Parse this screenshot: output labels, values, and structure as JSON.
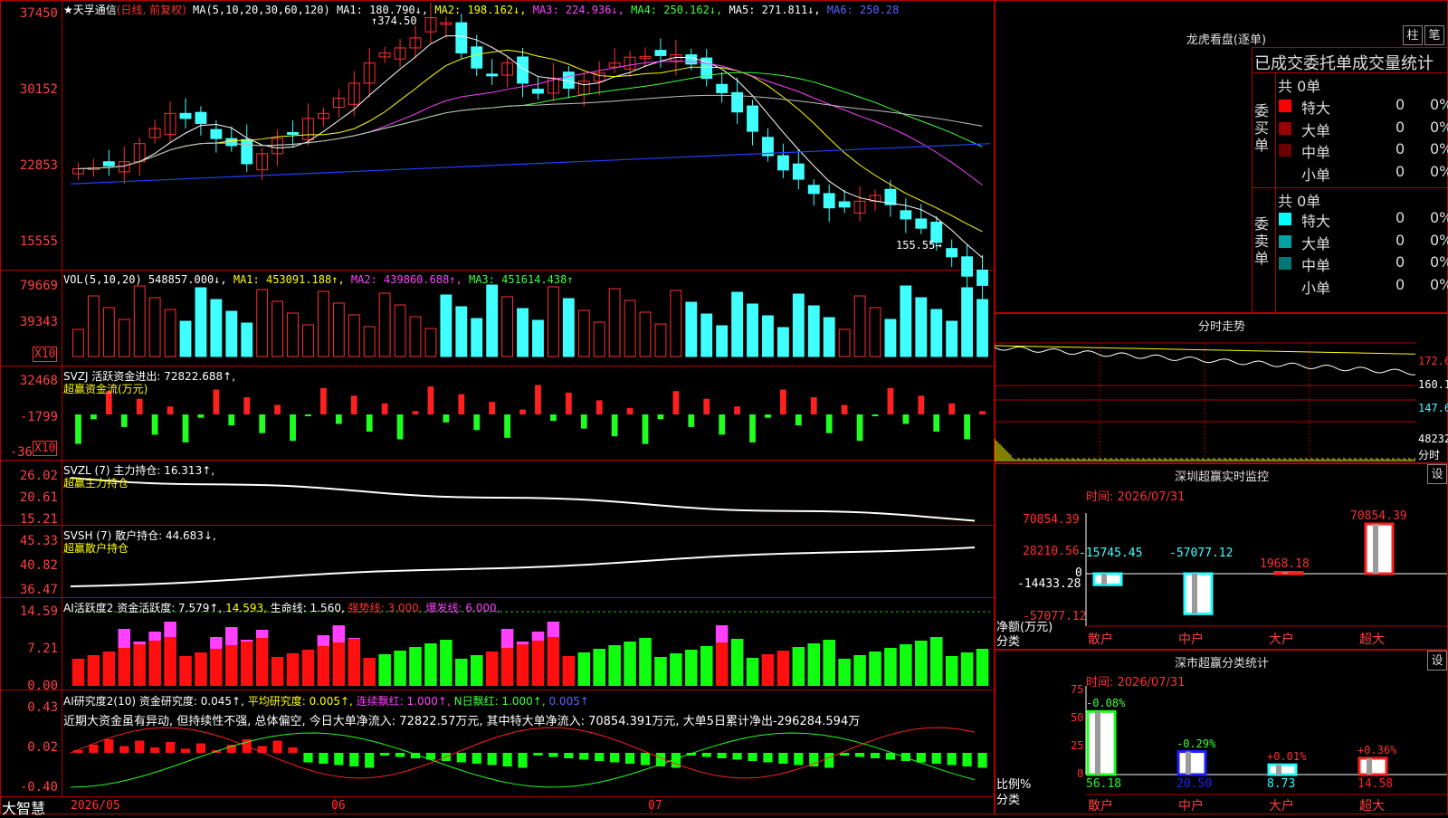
{
  "stock": {
    "name": "★天孚通信",
    "mode": "(日线, 前复权)"
  },
  "kline": {
    "y_labels": [
      "37450",
      "30152",
      "22853",
      "15555"
    ],
    "ma_header": {
      "label": "MA(5,10,20,30,60,120)",
      "ma1": "MA1: 180.790↓,",
      "ma2": "MA2: 198.162↓,",
      "ma3": "MA3: 224.936↓,",
      "ma4": "MA4: 250.162↓,",
      "ma5": "MA5: 271.811↓,",
      "ma6": "MA6: 250.28"
    },
    "high_mark": "374.50",
    "low_mark": "155.55"
  },
  "vol": {
    "header": {
      "label": "VOL(5,10,20) 548857.000↓,",
      "ma1": "MA1: 453091.188↑,",
      "ma2": "MA2: 439860.688↑,",
      "ma3": "MA3: 451614.438↑"
    },
    "y_labels": [
      "79669",
      "39343"
    ],
    "unit": "X10"
  },
  "svzj": {
    "header": "SVZJ  活跃资金进出: 72822.688↑,",
    "sub": "超赢资金流(万元)",
    "y_labels": [
      "32468",
      "-1799",
      "-36"
    ],
    "unit": "X10"
  },
  "svzl": {
    "header": "SVZL (7) 主力持仓: 16.313↑,",
    "sub": "超赢主力持仓",
    "y_labels": [
      "26.02",
      "20.61",
      "15.21"
    ]
  },
  "svsh": {
    "header": "SVSH (7) 散户持仓: 44.683↓,",
    "sub": "超赢散户持仓",
    "y_labels": [
      "45.33",
      "40.82",
      "36.47"
    ]
  },
  "ai1": {
    "header_a": "AI活跃度2 资金活跃度: 7.579↑,",
    "header_b": "14.593,",
    "header_c": "生命线: 1.560,",
    "header_d": "强势线: 3.000,",
    "header_e": "爆发线: 6.000,",
    "y_labels": [
      "14.59",
      "7.21",
      "0.00"
    ]
  },
  "ai2": {
    "header_a": "AI研究度2(10) 资金研究度: 0.045↑,",
    "header_b": "平均研究度: 0.005↑,",
    "header_c": "连续飘红: 1.000↑,",
    "header_d": "N日飘红: 1.000↑,",
    "header_e": "0.005↑",
    "comment": "近期大资金虽有异动, 但持续性不强, 总体偏空, 今日大单净流入: 72822.57万元, 其中特大单净流入: 70854.391万元, 大单5日累计净出-296284.594万",
    "y_labels": [
      "0.43",
      "0.02",
      "-0.40"
    ]
  },
  "footer": {
    "brand": "大智慧",
    "dates": [
      "2026/05",
      "06",
      "07"
    ]
  },
  "dragon": {
    "title": "龙虎看盘(逐单)",
    "btn_bar": "柱",
    "btn_pen": "笔",
    "subtitle": "已成交委托单成交量统计",
    "buy_label": "委买单",
    "sell_label": "委卖单",
    "buy_total": "共 0单",
    "sell_total": "共 0单",
    "buy_rows": [
      {
        "name": "特大",
        "count": "0",
        "pct": "0%",
        "color": "#ff0000"
      },
      {
        "name": "大单",
        "count": "0",
        "pct": "0%",
        "color": "#9a0000"
      },
      {
        "name": "中单",
        "count": "0",
        "pct": "0%",
        "color": "#6a0000"
      },
      {
        "name": "小单",
        "count": "0",
        "pct": "0%",
        "color": ""
      }
    ],
    "sell_rows": [
      {
        "name": "特大",
        "count": "0",
        "pct": "0%",
        "color": "#00ffff"
      },
      {
        "name": "大单",
        "count": "0",
        "pct": "0%",
        "color": "#00a0a0"
      },
      {
        "name": "中单",
        "count": "0",
        "pct": "0%",
        "color": "#007878"
      },
      {
        "name": "小单",
        "count": "0",
        "pct": "0%",
        "color": ""
      }
    ]
  },
  "intraday": {
    "title": "分时走势",
    "y_labels": [
      "172.6",
      "160.1",
      "147.6",
      "48232"
    ],
    "footer_label": "分时"
  },
  "monitor": {
    "title": "深圳超赢实时监控",
    "set_btn": "设",
    "time": "时间: 2026/07/31",
    "y_labels": [
      "70854.39",
      "28210.56",
      "0",
      "-14433.28",
      "-57077.12"
    ],
    "ylabel": "净额(万元)",
    "xlabel": "分类",
    "bars": [
      {
        "cat": "散户",
        "value": "-15745.45"
      },
      {
        "cat": "中户",
        "value": "-57077.12"
      },
      {
        "cat": "大户",
        "value": "1968.18"
      },
      {
        "cat": "超大",
        "value": "70854.39"
      }
    ]
  },
  "classify": {
    "title": "深市超赢分类统计",
    "set_btn": "设",
    "time": "时间: 2026/07/31",
    "y_labels": [
      "75",
      "50",
      "25",
      "0"
    ],
    "ylabel": "比例%",
    "xlabel": "分类",
    "bars": [
      {
        "cat": "散户",
        "value": "56.18",
        "change": "-0.08%"
      },
      {
        "cat": "中户",
        "value": "20.50",
        "change": "-0.29%"
      },
      {
        "cat": "大户",
        "value": "8.73",
        "change": "+0.01%"
      },
      {
        "cat": "超大",
        "value": "14.58",
        "change": "+0.36%"
      }
    ]
  }
}
